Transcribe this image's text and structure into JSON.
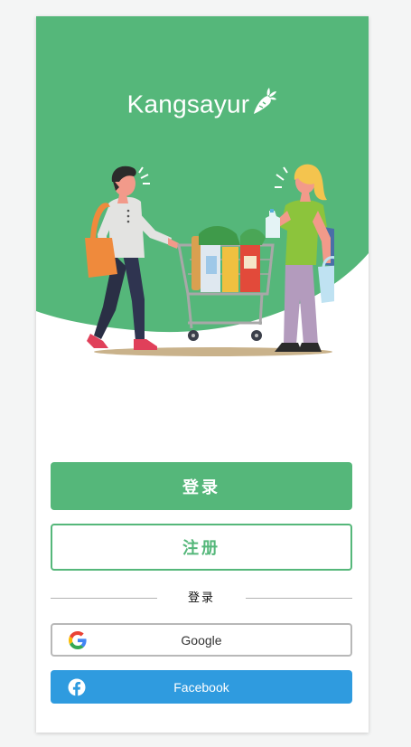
{
  "app": {
    "logo_text": "Kangsayur"
  },
  "actions": {
    "login_label": "登录",
    "register_label": "注册"
  },
  "divider": {
    "label": "登录"
  },
  "social": {
    "google_label": "Google",
    "facebook_label": "Facebook"
  },
  "icons": {
    "logo": "carrot-icon",
    "google": "google-icon",
    "facebook": "facebook-icon"
  },
  "colors": {
    "brand_green": "#55b77a",
    "facebook_blue": "#2f9bdf",
    "border_gray": "#b8b8b8",
    "page_background": "#f4f5f5"
  }
}
